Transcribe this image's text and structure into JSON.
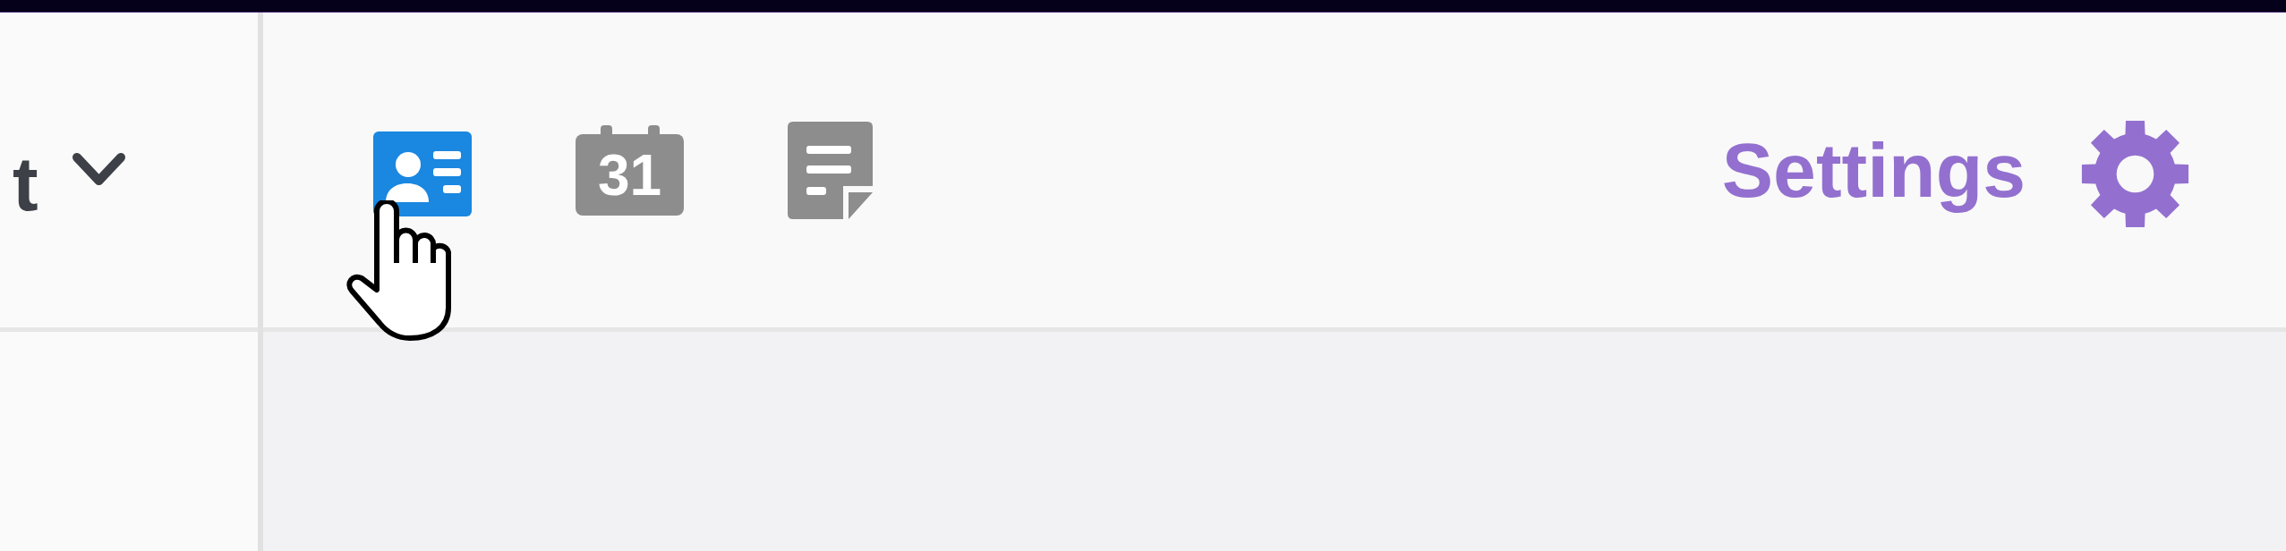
{
  "side_panel": {
    "dropdown": {
      "label": "t"
    }
  },
  "toolbar": {
    "views": [
      {
        "kind": "contact-card",
        "selected": true
      },
      {
        "kind": "calendar",
        "label": "31",
        "selected": false
      },
      {
        "kind": "note",
        "selected": false
      }
    ],
    "settings": {
      "label": "Settings"
    }
  }
}
